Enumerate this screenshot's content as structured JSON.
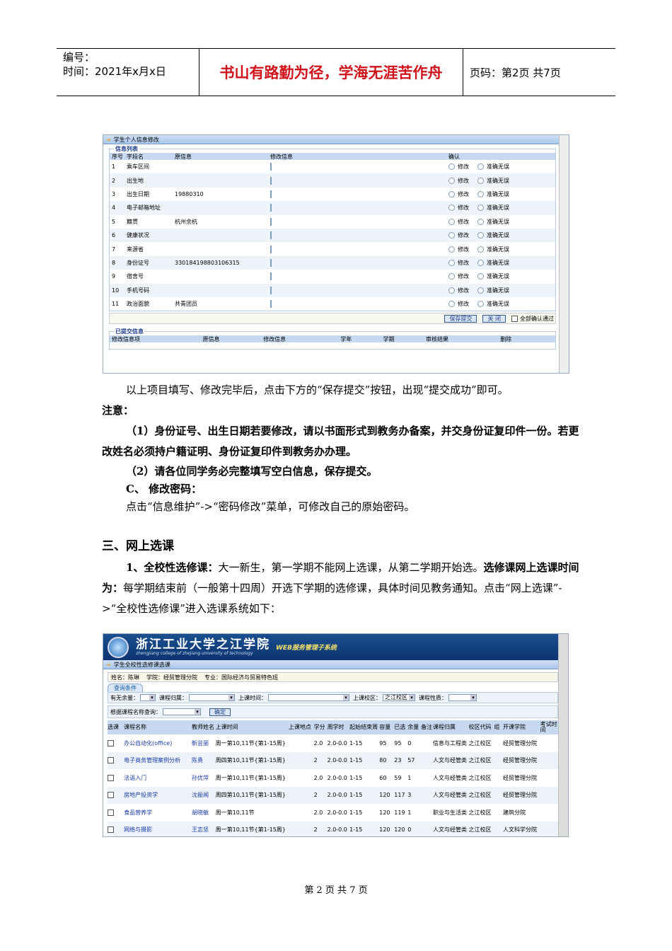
{
  "header": {
    "code_label": "编号：",
    "time_label": "时间：2021年x月x日",
    "motto": "书山有路勤为径，学海无涯苦作舟",
    "page_info": "页码：第2页  共7页"
  },
  "shot1": {
    "title": "学生个人信息修改",
    "list_legend": "信息列表",
    "columns": [
      "序号",
      "字段名",
      "原信息",
      "修改信息",
      "确认"
    ],
    "rows": [
      {
        "no": "1",
        "field": "乘车区间",
        "orig": ""
      },
      {
        "no": "2",
        "field": "出生地",
        "orig": ""
      },
      {
        "no": "3",
        "field": "出生日期",
        "orig": "19880310"
      },
      {
        "no": "4",
        "field": "电子邮箱地址",
        "orig": ""
      },
      {
        "no": "5",
        "field": "籍贯",
        "orig": "杭州余杭"
      },
      {
        "no": "6",
        "field": "健康状况",
        "orig": ""
      },
      {
        "no": "7",
        "field": "来源省",
        "orig": ""
      },
      {
        "no": "8",
        "field": "身份证号",
        "orig": "330184198803106315"
      },
      {
        "no": "9",
        "field": "宿舍号",
        "orig": ""
      },
      {
        "no": "10",
        "field": "手机号码",
        "orig": ""
      },
      {
        "no": "11",
        "field": "政治面貌",
        "orig": "共青团员"
      }
    ],
    "radio_modify": "修改",
    "radio_correct": "准确无误",
    "save_button": "保存提交",
    "close_button": "关 闭",
    "confirm_all": "全部确认通过",
    "submitted_legend": "已提交信息",
    "submitted_columns": [
      "修改信息项",
      "原信息",
      "修改信息",
      "学年",
      "学期",
      "审核结果",
      "删除"
    ]
  },
  "text": {
    "p1": "以上项目填写、修改完毕后，点击下方的“保存提交”按钮，出现“提交成功”即可。",
    "note": "注意：",
    "n1": "（1）身份证号、出生日期若要修改，请以书面形式到教务办备案，并交身份证复印件一份。若更改姓名必须持户籍证明、身份证复印件到教务办办理。",
    "n2": "（2）请各位同学务必完整填写空白信息，保存提交。",
    "c_title": "C、 修改密码：",
    "c_body": "点击“信息维护”->“密码修改”菜单，可修改自己的原始密码。",
    "sec3": "三、网上选课",
    "s1_bold": "1、全校性选修课：",
    "s1_a": "大一新生，第一学期不能网上选课，从第二学期开始选。",
    "s1_bold2": "选修课网上选课时间为：",
    "s1_b": "每学期结束前（一般第十四周）开选下学期的选修课，具体时间见教务通知。点击“网上选课”->“全校性选修课”进入选课系统如下："
  },
  "shot2": {
    "logo_cn": "浙江工业大学之江学院",
    "logo_en": "zhengjiang college of zhejiang university of technology",
    "system": "WEB服务管理子系统",
    "title": "学生全校性选修课选课",
    "student": {
      "name": "姓名：陈琳",
      "college": "学院：经贸管理分院",
      "major": "专业：国际经济与贸易特色班"
    },
    "query_tab": "查询条件",
    "filters": {
      "remain": "有无余量：",
      "category": "课程归属：",
      "time": "上课时间：",
      "campus": "上课校区：",
      "campus_value": "之江校区",
      "nature": "课程性质：",
      "by_name": "根据课程名称查询：",
      "ok": "确定"
    },
    "columns": [
      "选课",
      "课程名称",
      "教师姓名",
      "上课时间",
      "上课地点",
      "学分",
      "周学时",
      "起始结束周",
      "容量",
      "已选",
      "余量",
      "备注",
      "课程归属",
      "校区代码",
      "组",
      "开课学院",
      "考试时间"
    ],
    "rows": [
      {
        "name": "办公自动化(office)",
        "teacher": "靳芸丽",
        "time": "周一第10,11节{第1-15周}",
        "place": "",
        "credit": "2.0",
        "hours": "2.0-0.0",
        "weeks": "1-15",
        "cap": "95",
        "sel": "95",
        "rem": "0",
        "note": "",
        "cat": "信息与工程类",
        "campus": "之江校区",
        "group": "",
        "college": "经贸管理分院",
        "exam": ""
      },
      {
        "name": "电子商务管理案例分析",
        "teacher": "陈勇",
        "time": "周四第10,11节{第1-15周}",
        "place": "",
        "credit": "2",
        "hours": "2.0-0.0",
        "weeks": "1-15",
        "cap": "80",
        "sel": "23",
        "rem": "57",
        "note": "",
        "cat": "人文与经管类",
        "campus": "之江校区",
        "group": "",
        "college": "经贸管理分院",
        "exam": ""
      },
      {
        "name": "法语入门",
        "teacher": "孙优萍",
        "time": "周一第10,11节{第1-15周}",
        "place": "",
        "credit": "2.0",
        "hours": "2.0-0.0",
        "weeks": "1-15",
        "cap": "60",
        "sel": "59",
        "rem": "1",
        "note": "",
        "cat": "人文与经管类",
        "campus": "之江校区",
        "group": "",
        "college": "经贸管理分院",
        "exam": ""
      },
      {
        "name": "房地产投资学",
        "teacher": "沈振闻",
        "time": "周四第10,11节{第1-15周}",
        "place": "",
        "credit": "2",
        "hours": "2.0-0.0",
        "weeks": "1-15",
        "cap": "120",
        "sel": "117",
        "rem": "3",
        "note": "",
        "cat": "人文与经管类",
        "campus": "之江校区",
        "group": "",
        "college": "经贸管理分院",
        "exam": ""
      },
      {
        "name": "食品营养学",
        "teacher": "胡晓敏",
        "time": "周一第10,11节",
        "place": "",
        "credit": "2.0",
        "hours": "2.0-0.0",
        "weeks": "1-15",
        "cap": "120",
        "sel": "119",
        "rem": "1",
        "note": "",
        "cat": "职业与生活类",
        "campus": "之江校区",
        "group": "",
        "college": "建筑分院",
        "exam": ""
      },
      {
        "name": "网络与摄影",
        "teacher": "王志坚",
        "time": "周一第10,11节{第1-15周}",
        "place": "",
        "credit": "2",
        "hours": "2.0-0.0",
        "weeks": "1-15",
        "cap": "120",
        "sel": "120",
        "rem": "0",
        "note": "",
        "cat": "人文与经管类",
        "campus": "之江校区",
        "group": "",
        "college": "人文科学分院",
        "exam": ""
      }
    ]
  },
  "footer": "第 2 页 共 7 页"
}
